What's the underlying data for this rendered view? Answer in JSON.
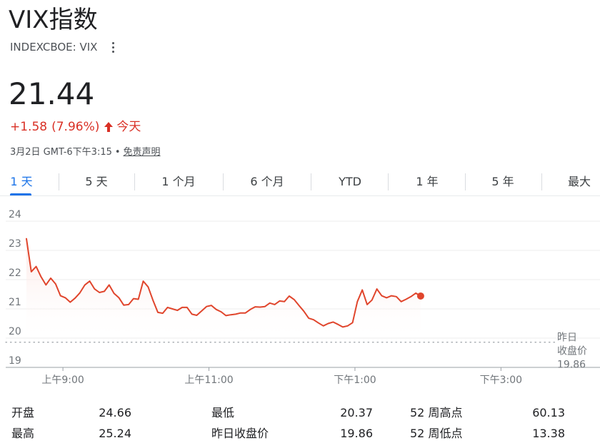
{
  "header": {
    "title": "VIX指数",
    "ticker": "INDEXCBOE: VIX"
  },
  "quote": {
    "price": "21.44",
    "change": "+1.58",
    "change_percent": "(7.96%)",
    "period": "今天",
    "timestamp": "3月2日 GMT-6下午3:15",
    "separator": "•",
    "disclaimer": "免责声明",
    "direction_icon": "arrow-up-icon",
    "color_up": "#d93025"
  },
  "tabs": [
    {
      "label": "1 天",
      "active": true
    },
    {
      "label": "5 天",
      "active": false
    },
    {
      "label": "1 个月",
      "active": false
    },
    {
      "label": "6 个月",
      "active": false
    },
    {
      "label": "YTD",
      "active": false
    },
    {
      "label": "1 年",
      "active": false
    },
    {
      "label": "5 年",
      "active": false
    },
    {
      "label": "最大",
      "active": false
    }
  ],
  "colors": {
    "line": "#e0452c",
    "fill_top": "#fbe3e0",
    "active_tab": "#1a73e8"
  },
  "chart_data": {
    "type": "area",
    "ylim": [
      19,
      24
    ],
    "yticks": [
      19,
      20,
      21,
      22,
      23,
      24
    ],
    "xlim": [
      8.5,
      15.75
    ],
    "xticks": [
      {
        "value": 9,
        "label": "上午9:00"
      },
      {
        "value": 11,
        "label": "上午11:00"
      },
      {
        "value": 13,
        "label": "下午1:00"
      },
      {
        "value": 15,
        "label": "下午3:00"
      }
    ],
    "grid": true,
    "previous_close": 19.86,
    "previous_close_label": [
      "昨日",
      "收盘价",
      "19.86"
    ],
    "x": [
      8.5,
      8.567,
      8.633,
      8.7,
      8.767,
      8.833,
      8.9,
      8.967,
      9.033,
      9.1,
      9.167,
      9.233,
      9.3,
      9.367,
      9.433,
      9.5,
      9.567,
      9.633,
      9.7,
      9.767,
      9.833,
      9.9,
      9.967,
      10.033,
      10.1,
      10.167,
      10.233,
      10.3,
      10.367,
      10.433,
      10.5,
      10.567,
      10.633,
      10.7,
      10.767,
      10.833,
      10.9,
      10.967,
      11.033,
      11.1,
      11.167,
      11.233,
      11.3,
      11.367,
      11.433,
      11.5,
      11.567,
      11.633,
      11.7,
      11.767,
      11.833,
      11.9,
      11.967,
      12.033,
      12.1,
      12.167,
      12.233,
      12.3,
      12.367,
      12.433,
      12.5,
      12.567,
      12.633,
      12.7,
      12.767,
      12.833,
      12.9,
      12.967,
      13.033,
      13.1,
      13.167,
      13.233,
      13.3,
      13.367,
      13.433,
      13.5,
      13.567,
      13.633,
      13.7,
      13.767,
      13.833,
      13.9,
      13.967,
      14.033,
      14.1,
      14.167,
      14.233,
      14.3,
      14.367,
      14.433,
      14.5,
      14.567,
      14.633,
      14.7,
      14.767,
      14.833,
      14.9,
      14.967,
      15.033,
      15.1,
      15.167,
      15.25
    ],
    "series": [
      {
        "values": [
          23.4,
          22.27,
          22.45,
          22.1,
          21.82,
          22.05,
          21.85,
          21.45,
          21.38,
          21.23,
          21.37,
          21.55,
          21.82,
          21.95,
          21.68,
          21.56,
          21.6,
          21.82,
          21.53,
          21.38,
          21.13,
          21.15,
          21.35,
          21.33,
          21.95,
          21.75,
          21.3,
          20.88,
          20.85,
          21.05,
          21.0,
          20.95,
          21.05,
          21.05,
          20.82,
          20.78,
          20.93,
          21.08,
          21.12,
          20.98,
          20.9,
          20.77,
          20.8,
          20.82,
          20.86,
          20.86,
          20.98,
          21.07,
          21.06,
          21.08,
          21.2,
          21.15,
          21.27,
          21.25,
          21.44,
          21.32,
          21.12,
          20.92,
          20.68,
          20.63,
          20.52,
          20.42,
          20.5,
          20.55,
          20.47,
          20.38,
          20.42,
          20.53,
          21.25,
          21.65,
          21.15,
          21.3,
          21.68,
          21.45,
          21.38,
          21.45,
          21.42,
          21.25,
          21.33,
          21.42,
          21.54,
          21.44
        ]
      }
    ]
  }
}
